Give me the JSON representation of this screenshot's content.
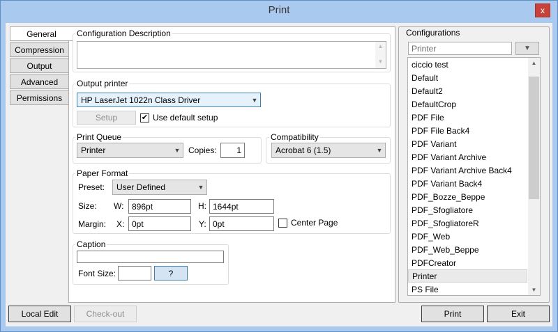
{
  "window": {
    "title": "Print",
    "close_glyph": "x"
  },
  "tabs": [
    {
      "label": "General"
    },
    {
      "label": "Compression"
    },
    {
      "label": "Output"
    },
    {
      "label": "Advanced"
    },
    {
      "label": "Permissions"
    }
  ],
  "config_description": {
    "label": "Configuration Description",
    "value": ""
  },
  "output_printer": {
    "label": "Output printer",
    "selected": "HP LaserJet 1022n Class Driver",
    "setup_label": "Setup",
    "use_default_label": "Use default setup",
    "use_default_checked": true
  },
  "print_queue": {
    "label": "Print Queue",
    "selected": "Printer",
    "copies_label": "Copies:",
    "copies": "1"
  },
  "compatibility": {
    "label": "Compatibility",
    "selected": "Acrobat 6 (1.5)"
  },
  "paper_format": {
    "label": "Paper Format",
    "preset_label": "Preset:",
    "preset": "User Defined",
    "size_label": "Size:",
    "w_label": "W:",
    "w_value": "896pt",
    "h_label": "H:",
    "h_value": "1644pt",
    "margin_label": "Margin:",
    "x_label": "X:",
    "x_value": "0pt",
    "y_label": "Y:",
    "y_value": "0pt",
    "center_page_label": "Center Page",
    "center_page_checked": false
  },
  "caption": {
    "label": "Caption",
    "value": "",
    "font_size_label": "Font Size:",
    "font_size_value": "",
    "help_label": "?"
  },
  "configurations": {
    "label": "Configurations",
    "search_value": "Printer",
    "items": [
      "ciccio test",
      "Default",
      "Default2",
      "DefaultCrop",
      "PDF File",
      "PDF File Back4",
      "PDF Variant",
      "PDF Variant Archive",
      "PDF Variant Archive Back4",
      "PDF Variant Back4",
      "PDF_Bozze_Beppe",
      "PDF_Sfogliatore",
      "PDF_SfogliatoreR",
      "PDF_Web",
      "PDF_Web_Beppe",
      "PDFCreator",
      "Printer",
      "PS File"
    ],
    "selected": "Printer"
  },
  "footer": {
    "local_edit_label": "Local Edit",
    "checkout_label": "Check-out",
    "print_label": "Print",
    "exit_label": "Exit"
  }
}
